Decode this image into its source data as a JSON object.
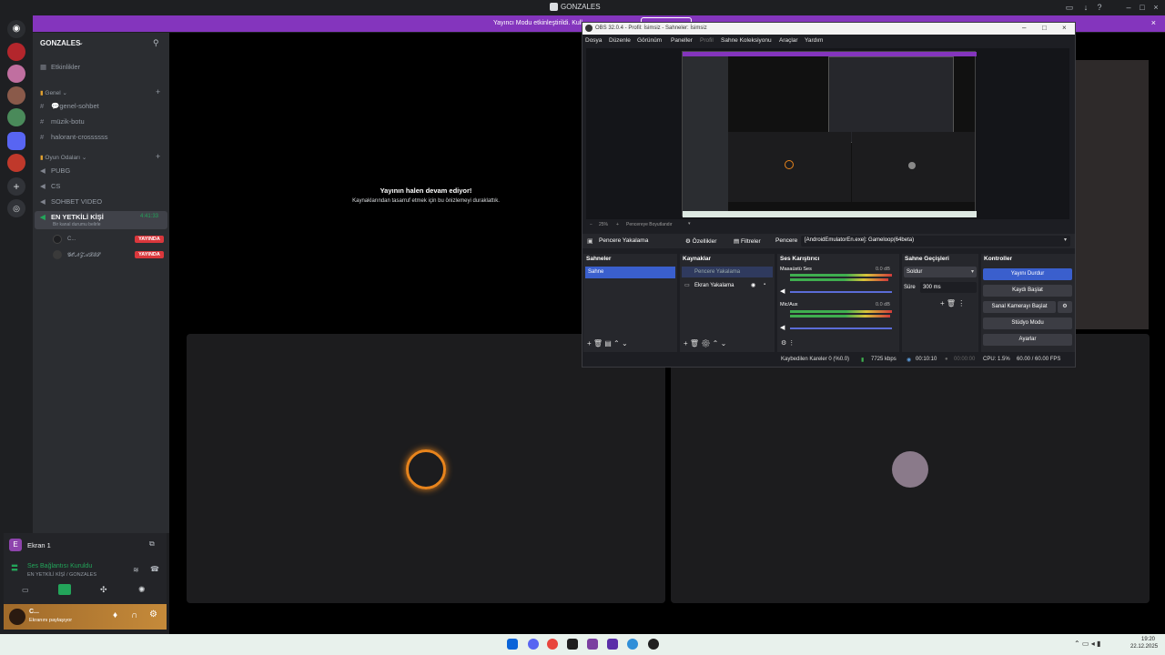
{
  "discord": {
    "window_title": "GONZALES",
    "banner_text": "Yayıncı Modu etkinleştirildi. Kull",
    "server_name": "GONZALES",
    "events_label": "Etkinlikler",
    "categories": [
      {
        "name": "Genel",
        "channels": [
          "💬genel-sohbet",
          "müzik-botu",
          "halorant-crossssss"
        ]
      },
      {
        "name": "Oyun Odaları",
        "channels": [
          "PUBG",
          "CS",
          "SOHBET VIDEO"
        ]
      }
    ],
    "active_voice": {
      "name": "EN YETKİLİ KİŞİ",
      "timer": "4:41:33",
      "subtitle": "Bir kanal durumu belirle"
    },
    "voice_members": [
      {
        "name": "C...",
        "badge": "YAYINDA"
      },
      {
        "name": "𝓖𝓞𝓝𝓩𝓐𝓛𝓔𝓢",
        "badge": "YAYINDA"
      }
    ],
    "ekran_label": "Ekran 1",
    "connection": {
      "status": "Ses Bağlantısı Kuruldu",
      "location": "EN YETKİLİ KİŞİ / GONZALES"
    },
    "user": {
      "name": "C...",
      "status": "Ekranını paylaşıyor"
    },
    "stream_paused_title": "Yayının halen devam ediyor!",
    "stream_paused_sub": "Kaynaklarından tasarruf etmek için bu önizlemeyi duraklattık."
  },
  "obs": {
    "title": "OBS 32.0.4 - Profil: İsimsiz - Sahneler: İsimsiz",
    "menu": [
      "Dosya",
      "Düzenle",
      "Görünüm",
      "Paneller",
      "Profil",
      "Sahne Koleksiyonu",
      "Araçlar",
      "Yardım"
    ],
    "zoom": "25%",
    "zoom_mode": "Pencereye Boyutlandır",
    "source_bar": {
      "source": "Pencere Yakalama",
      "properties": "Özellikler",
      "filters": "Filtreler",
      "window_label": "Pencere",
      "window_value": "[AndroidEmulatorEn.exe]: Gameloop(64beta)"
    },
    "scenes_title": "Sahneler",
    "scenes": [
      "Sahne"
    ],
    "sources_title": "Kaynaklar",
    "sources": [
      "Pencere Yakalama",
      "Ekran Yakalama"
    ],
    "mixer_title": "Ses Karıştırıcı",
    "mixer": [
      {
        "name": "Masaüstü Ses",
        "db": "0.0 dB"
      },
      {
        "name": "Mic/Aux",
        "db": "0.0 dB"
      }
    ],
    "transitions_title": "Sahne Geçişleri",
    "transition": "Soldur",
    "duration_label": "Süre",
    "duration": "300 ms",
    "controls_title": "Kontroller",
    "controls": [
      "Yayını Durdur",
      "Kaydı Başlat",
      "Sanal Kamerayı Başlat",
      "Stüdyo Modu",
      "Ayarlar"
    ],
    "status": {
      "dropped": "Kaybedilen Kareler 0 (%0.0)",
      "bitrate": "7725 kbps",
      "stream_time": "00:10:10",
      "rec_time": "00:00:00",
      "cpu": "CPU: 1.5%",
      "fps": "60.00 / 60.00 FPS"
    }
  },
  "taskbar": {
    "time": "19:20",
    "date": "22.12.2025"
  },
  "colors": {
    "accent": "#5865f2",
    "live": "#da373c",
    "banner": "#8435bd",
    "obs_active": "#3a5fcd"
  }
}
